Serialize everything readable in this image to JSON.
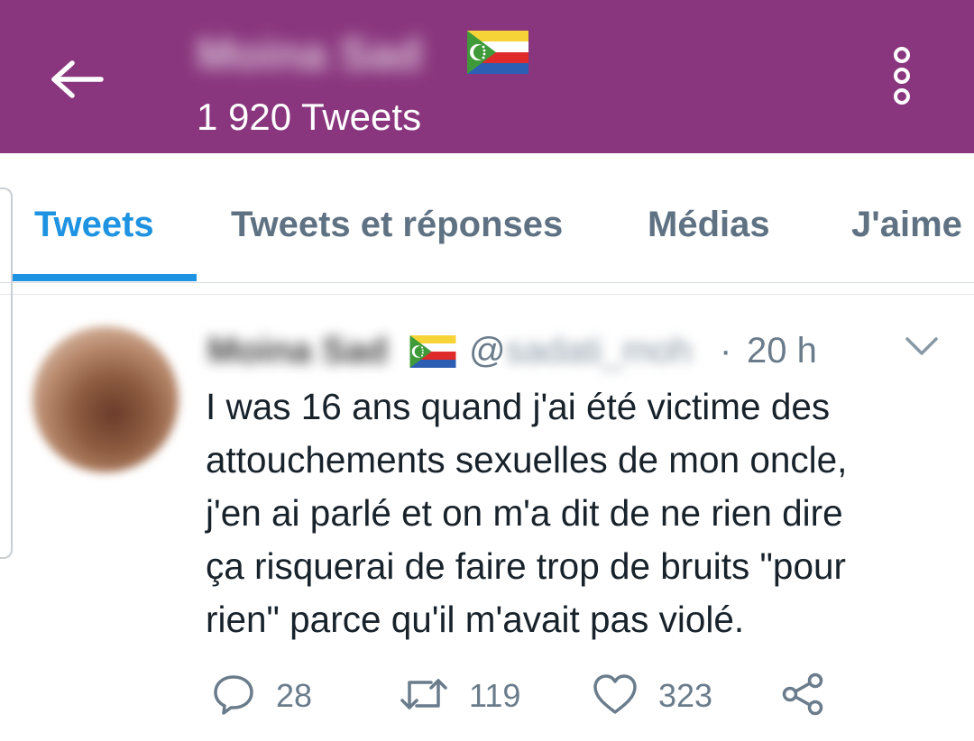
{
  "colors": {
    "header_bg": "#8a367e",
    "accent": "#1e93e2",
    "muted_text": "#6a7c8b",
    "body_text": "#18222b"
  },
  "header": {
    "back_icon": "arrow-left-icon",
    "profile_name": "Moina Sad",
    "flag_icon": "comoros-flag-icon",
    "tweet_count": "1 920 Tweets",
    "overflow_icon": "more-vertical-icon"
  },
  "tabs": [
    {
      "label": "Tweets",
      "active": true
    },
    {
      "label": "Tweets et réponses",
      "active": false
    },
    {
      "label": "Médias",
      "active": false
    },
    {
      "label": "J'aime",
      "active": false
    }
  ],
  "tweet": {
    "author_name": "Moina Sad",
    "handle_prefix": "@",
    "handle_rest": "sadati_moh",
    "separator": "·",
    "time": "20 h",
    "text_lines": [
      "I was 16 ans quand j'ai été victime des",
      "attouchements sexuelles de mon oncle,",
      "j'en ai parlé et on m'a dit de ne rien dire",
      "ça risquerai de faire trop de bruits \"pour",
      "rien\" parce qu'il m'avait pas violé."
    ],
    "actions": {
      "reply": {
        "icon": "reply-icon",
        "count": "28"
      },
      "retweet": {
        "icon": "retweet-icon",
        "count": "119"
      },
      "like": {
        "icon": "heart-icon",
        "count": "323"
      },
      "share": {
        "icon": "share-icon"
      }
    }
  }
}
